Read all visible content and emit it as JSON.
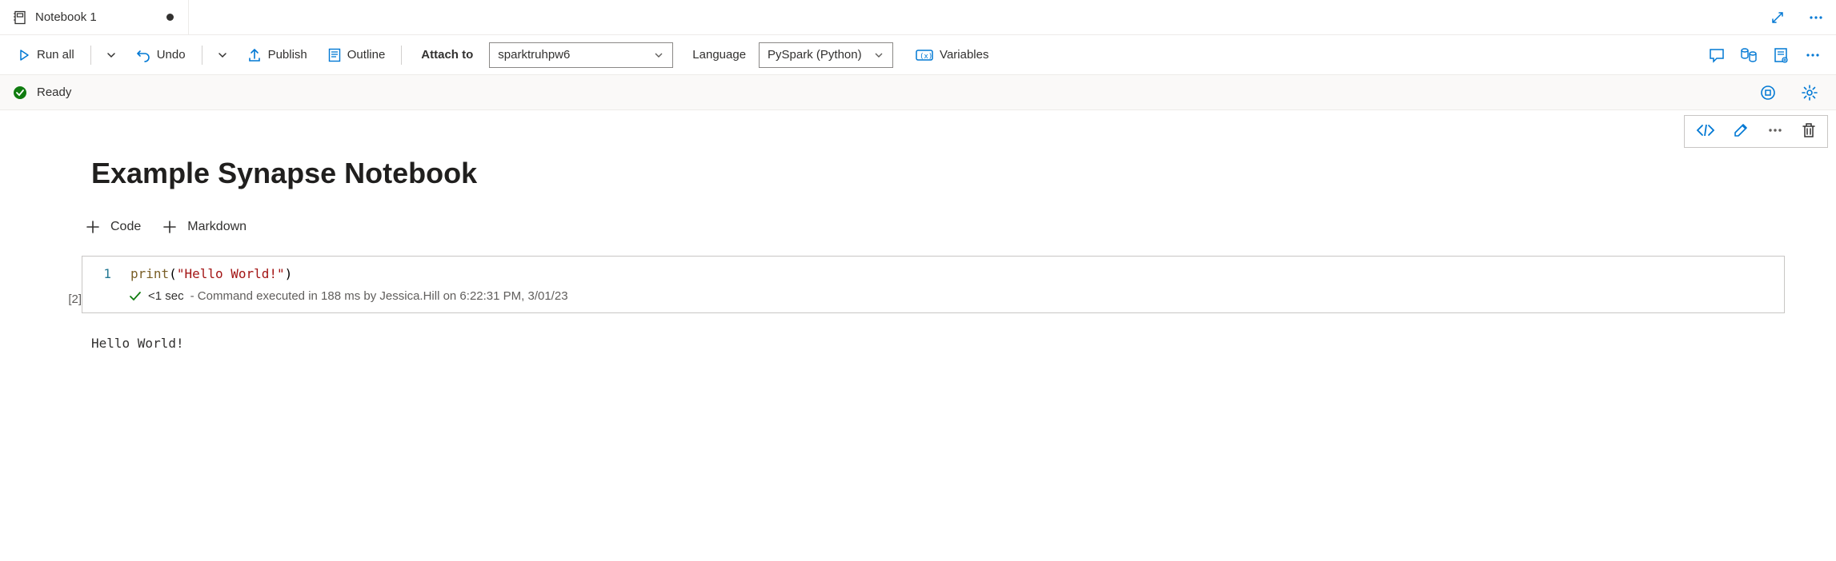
{
  "tab": {
    "title": "Notebook 1"
  },
  "toolbar": {
    "run_all": "Run all",
    "undo": "Undo",
    "publish": "Publish",
    "outline": "Outline",
    "attach_to_label": "Attach to",
    "attach_to_value": "sparktruhpw6",
    "language_label": "Language",
    "language_value": "PySpark (Python)",
    "variables": "Variables"
  },
  "status": {
    "text": "Ready"
  },
  "heading": "Example Synapse Notebook",
  "add": {
    "code": "Code",
    "markdown": "Markdown"
  },
  "cell": {
    "exec_count": "[2]",
    "line_number": "1",
    "code_fn": "print",
    "code_open": "(",
    "code_str": "\"Hello World!\"",
    "code_close": ")",
    "exec_duration": "<1 sec",
    "exec_detail": " - Command executed in 188 ms by Jessica.Hill on 6:22:31 PM, 3/01/23",
    "output": "Hello World!"
  }
}
